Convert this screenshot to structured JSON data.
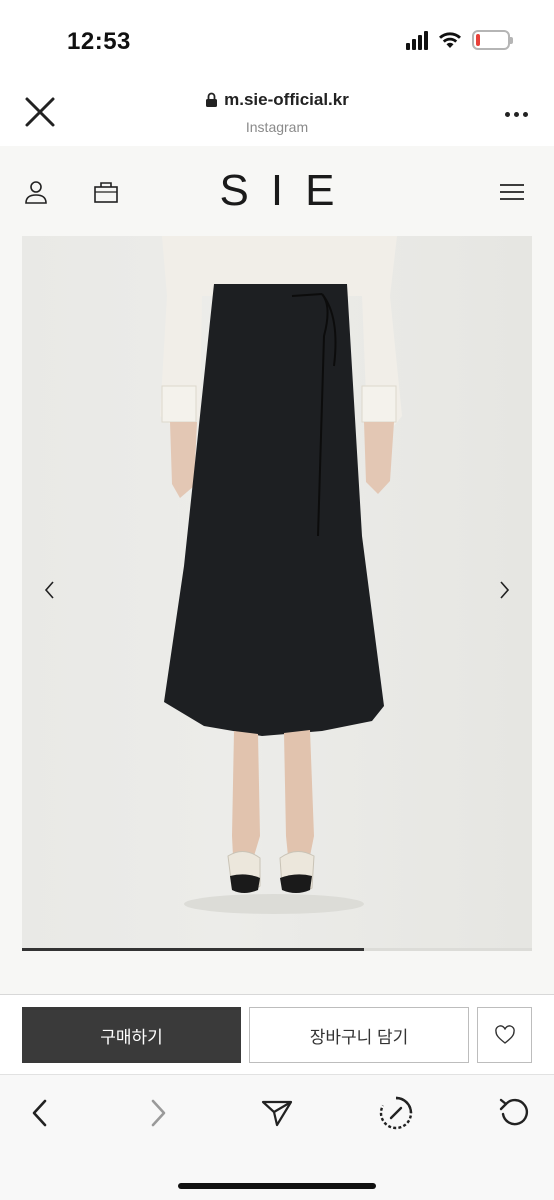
{
  "status_bar": {
    "time": "12:53",
    "icons": [
      "cellular-signal-icon",
      "wifi-icon",
      "battery-low-icon"
    ],
    "battery_color": "#e8413a"
  },
  "browser": {
    "url": "m.sie-official.kr",
    "subtitle": "Instagram",
    "icons": [
      "close-icon",
      "lock-icon",
      "more-icon"
    ]
  },
  "site": {
    "logo": "SIE",
    "icons": [
      "user-icon",
      "shopping-bag-icon",
      "hamburger-menu-icon"
    ]
  },
  "product": {
    "image_description": "model wearing white blouse and black midi skirt with tie waist",
    "carousel_icons": [
      "chevron-left-icon",
      "chevron-right-icon"
    ],
    "carousel_progress": 0.67
  },
  "purchase": {
    "buy_label": "구매하기",
    "cart_label": "장바구니 담기",
    "wishlist_icon": "heart-icon",
    "buy_color": "#3a3a3a"
  },
  "toolbar": {
    "icons": [
      "back-arrow-icon",
      "forward-arrow-icon",
      "share-send-icon",
      "compass-timer-icon",
      "reload-icon"
    ]
  }
}
